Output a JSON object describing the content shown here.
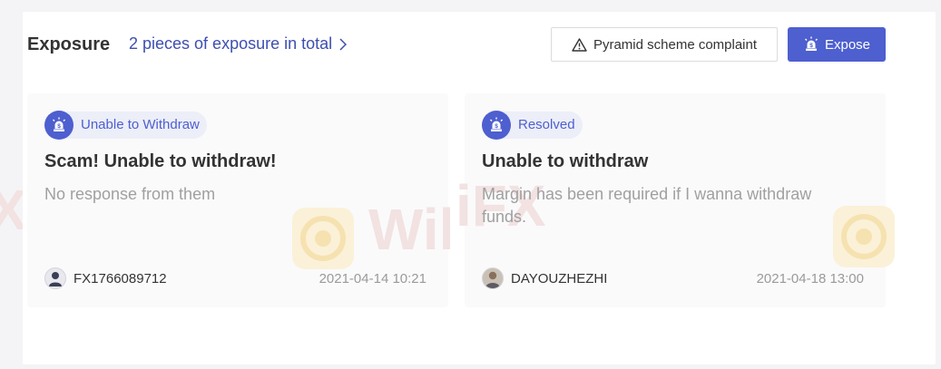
{
  "header": {
    "title": "Exposure",
    "total_link": "2 pieces of exposure in total",
    "complaint_button": "Pyramid scheme complaint",
    "expose_button": "Expose"
  },
  "cards": [
    {
      "tag": "Unable to Withdraw",
      "title": "Scam! Unable to withdraw!",
      "description": "No response from them",
      "user": "FX1766089712",
      "date": "2021-04-14 10:21"
    },
    {
      "tag": "Resolved",
      "title": "Unable to withdraw",
      "description": "Margin has been required if I wanna withdraw funds.",
      "user": "DAYOUZHEZHI",
      "date": "2021-04-18 13:00"
    }
  ],
  "watermark": {
    "text": "WikiFX"
  },
  "colors": {
    "accent": "#4e5fcf",
    "link": "#3d4fb0",
    "tag_bg": "#eceef8"
  },
  "icons": {
    "complaint": "warning-triangle-icon",
    "expose": "alarm-siren-icon",
    "tag": "alarm-siren-icon",
    "total_link": "chevron-right-icon"
  }
}
